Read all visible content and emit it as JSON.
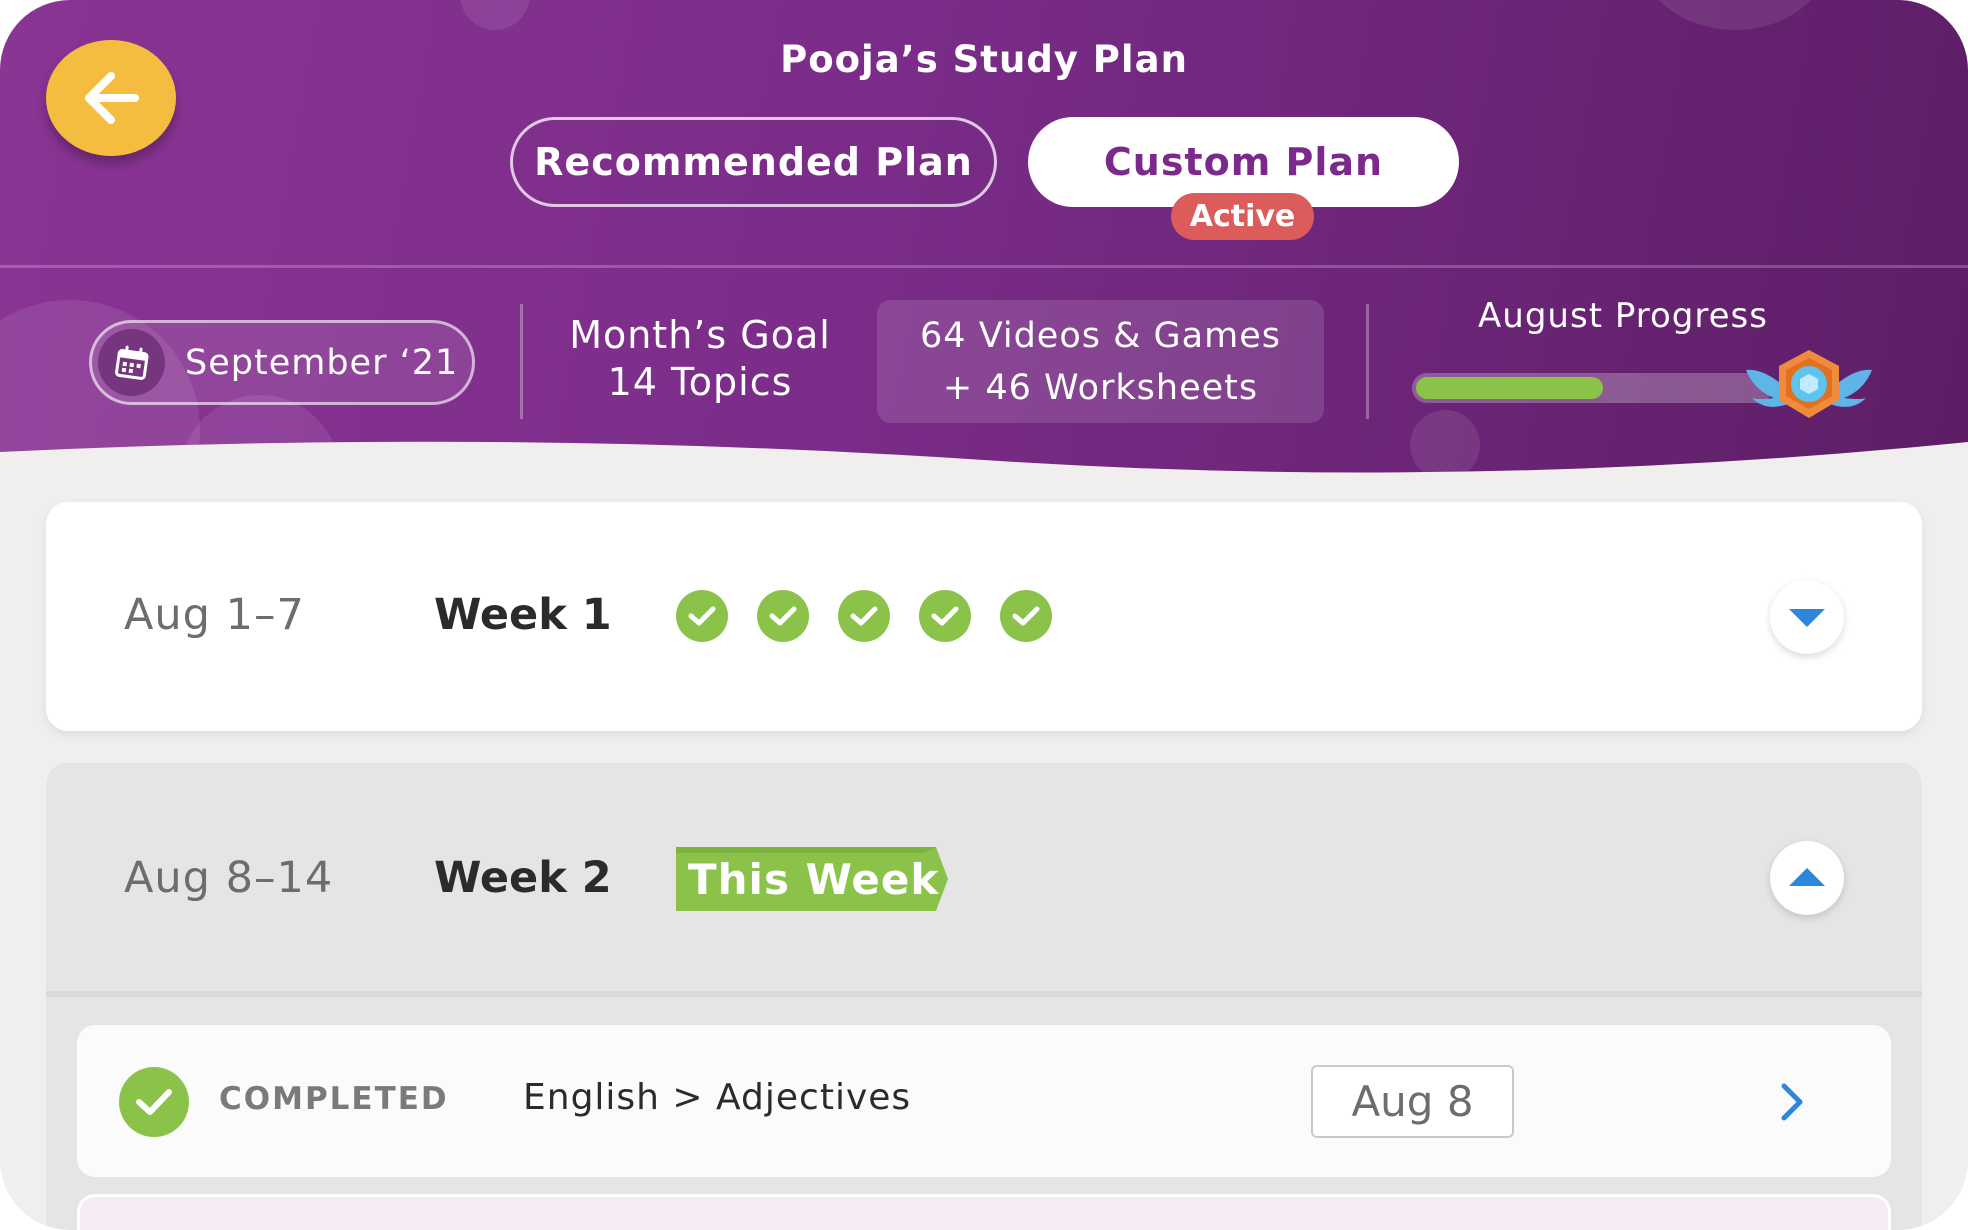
{
  "header": {
    "title": "Pooja’s Study Plan",
    "tabs": [
      {
        "label": "Recommended Plan",
        "active": false
      },
      {
        "label": "Custom Plan",
        "active": true,
        "badge": "Active"
      }
    ],
    "month_selector": {
      "label": "September ‘21",
      "icon": "calendar-icon"
    },
    "goal": {
      "line1": "Month’s Goal",
      "line2": "14 Topics"
    },
    "content_summary": {
      "line1": "64 Videos & Games",
      "line2": "+ 46 Worksheets"
    },
    "progress": {
      "title": "August Progress",
      "fraction": 0.53,
      "icon": "medal-icon"
    }
  },
  "weeks": [
    {
      "range": "Aug 1–7",
      "name": "Week 1",
      "completed_checks": 5,
      "expanded": false
    },
    {
      "range": "Aug 8–14",
      "name": "Week 2",
      "tag": "This Week",
      "expanded": true,
      "tasks": [
        {
          "status": "COMPLETED",
          "topic": "English > Adjectives",
          "date": "Aug 8"
        }
      ]
    }
  ],
  "colors": {
    "header_purple": "#7a2c88",
    "accent_green": "#8bc34a",
    "back_button": "#f5bd3f",
    "active_badge": "#dc5b5b",
    "toggle_arrow": "#2d86d9"
  }
}
